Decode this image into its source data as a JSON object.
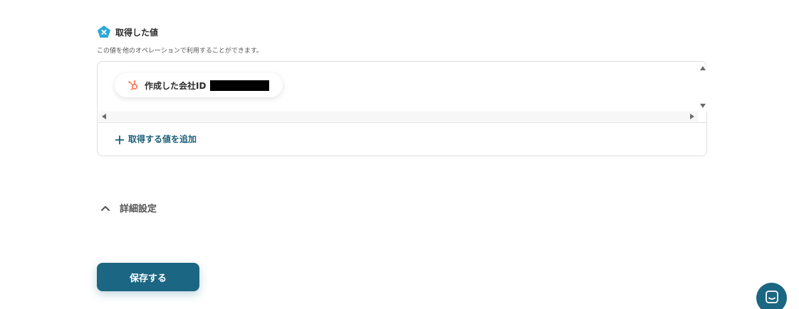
{
  "section": {
    "title": "取得した値",
    "description": "この値を他のオペレーションで利用することができます。",
    "icon": "pentagon-x-icon"
  },
  "value_box": {
    "chip": {
      "icon": "hubspot-icon",
      "label": "作成した会社ID",
      "value_redacted": true
    },
    "add_label": "取得する値を追加"
  },
  "details": {
    "label": "詳細設定",
    "expanded": true
  },
  "footer": {
    "save_label": "保存する"
  },
  "colors": {
    "accent": "#1b6682",
    "link": "#1b5f78",
    "hubspot": "#ff7a59",
    "pentagon": "#2aa8d8"
  }
}
